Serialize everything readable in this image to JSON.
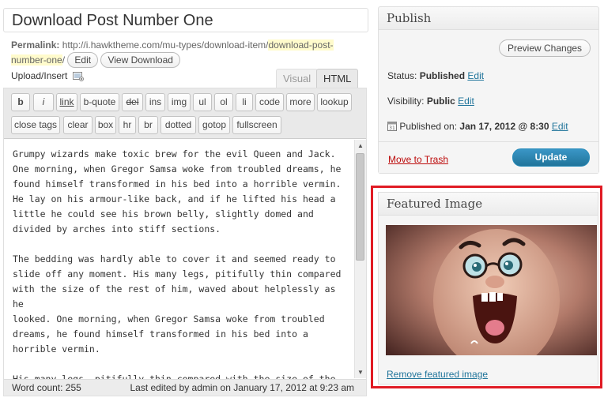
{
  "title": "Download Post Number One",
  "permalink": {
    "label": "Permalink:",
    "base": "http://i.hawktheme.com/mu-types/download-item/",
    "slug_line1": "download-post-",
    "slug_line2": "number-one",
    "trailing": "/",
    "edit_label": "Edit",
    "view_label": "View Download"
  },
  "upload_insert": "Upload/Insert",
  "tabs": {
    "visual": "Visual",
    "html": "HTML"
  },
  "toolbar": {
    "row1": [
      "b",
      "i",
      "link",
      "b-quote",
      "del",
      "ins",
      "img",
      "ul",
      "ol",
      "li",
      "code",
      "more",
      "lookup"
    ],
    "row2": [
      "close tags",
      "clear",
      "box",
      "hr",
      "br",
      "dotted",
      "gotop",
      "fullscreen"
    ]
  },
  "content": {
    "p1": "Grumpy wizards make toxic brew for the evil Queen and Jack.\nOne morning, when Gregor Samsa woke from troubled dreams, he\nfound himself transformed in his bed into a horrible vermin.\nHe lay on his armour-like back, and if he lifted his head a\nlittle he could see his brown belly, slightly domed and\ndivided by arches into stiff sections.",
    "p2": "The bedding was hardly able to cover it and seemed ready to\nslide off any moment. His many legs, pitifully thin compared\nwith the size of the rest of him, waved about helplessly as he\nlooked. One morning, when Gregor Samsa woke from troubled\ndreams, he found himself transformed in his bed into a\nhorrible vermin.",
    "p3": "His many legs, pitifully thin compared with the size of the"
  },
  "status": {
    "word_count": "Word count: 255",
    "last_edited": "Last edited by admin on January 17, 2012 at 9:23 am"
  },
  "publish": {
    "heading": "Publish",
    "preview_label": "Preview Changes",
    "status_label": "Status:",
    "status_value": "Published",
    "visibility_label": "Visibility:",
    "visibility_value": "Public",
    "published_label": "Published on:",
    "published_value": "Jan 17, 2012 @ 8:30",
    "edit_label": "Edit",
    "trash_label": "Move to Trash",
    "update_label": "Update"
  },
  "featured": {
    "heading": "Featured Image",
    "remove_label": "Remove featured image"
  },
  "colors": {
    "link": "#21759b",
    "trash": "#bc0b0b",
    "primary_button": "#21759b",
    "highlight_outline": "#e01b24"
  }
}
